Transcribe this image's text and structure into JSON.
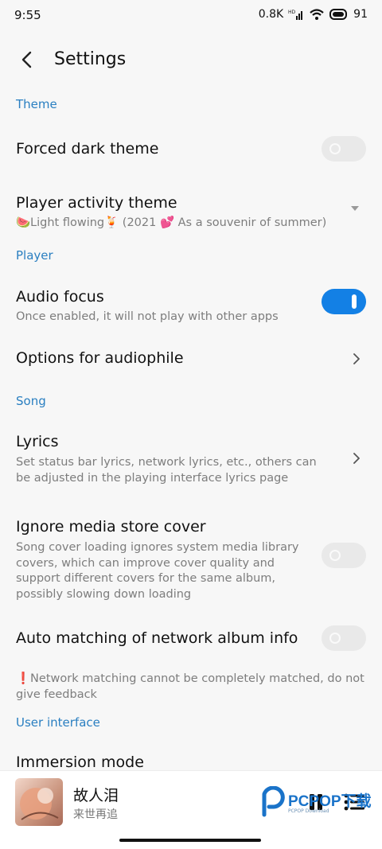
{
  "status_bar": {
    "time": "9:55",
    "net_speed": "0.8K",
    "battery": "91"
  },
  "header": {
    "title": "Settings"
  },
  "sections": {
    "theme": "Theme",
    "player": "Player",
    "song": "Song",
    "ui": "User interface"
  },
  "items": {
    "forced_dark": {
      "title": "Forced dark theme",
      "enabled": false
    },
    "player_theme": {
      "title": "Player activity theme",
      "value": "🍉Light flowing🍹 (2021 💕 As a souvenir of summer)"
    },
    "audio_focus": {
      "title": "Audio focus",
      "subtitle": "Once enabled, it will not play with other apps",
      "enabled": true
    },
    "audiophile": {
      "title": "Options for audiophile"
    },
    "lyrics": {
      "title": "Lyrics",
      "subtitle": "Set status bar lyrics, network lyrics, etc., others can be adjusted in the playing interface lyrics page"
    },
    "ignore_cover": {
      "title": "Ignore media store cover",
      "subtitle": "Song cover loading ignores system media library covers, which can improve cover quality and support different covers for the same album, possibly slowing down loading",
      "enabled": false
    },
    "auto_album": {
      "title": "Auto matching of network album info",
      "enabled": false
    },
    "network_note": "❗Network matching cannot be completely matched, do not give feedback",
    "immersion": {
      "title": "Immersion mode"
    }
  },
  "now_playing": {
    "song": "故人泪",
    "artist": "来世再追"
  },
  "watermark": {
    "brand": "PCPOP下载",
    "sub": "PCPOP Download"
  },
  "colors": {
    "accent": "#1380e5",
    "section": "#2a7fc1"
  }
}
